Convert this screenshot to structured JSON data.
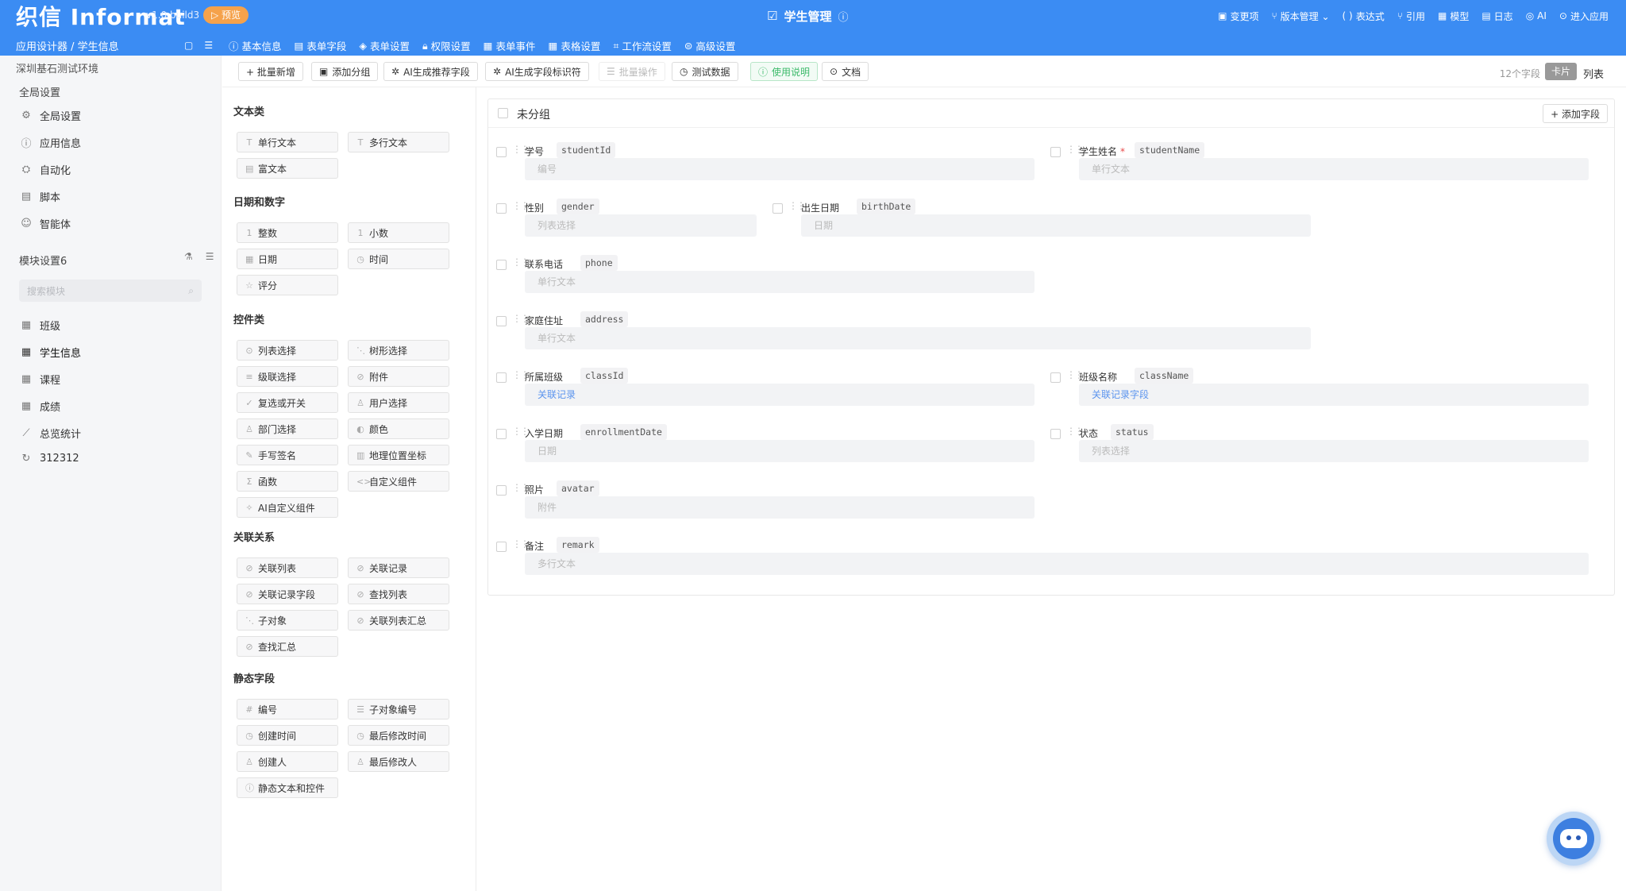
{
  "header": {
    "logo": "织信 Informat",
    "version": "v1.0 build3",
    "preview_label": "▷ 预览",
    "app_title": "学生管理",
    "actions": [
      {
        "icon": "changes-icon",
        "label": "变更项"
      },
      {
        "icon": "version-icon",
        "label": "版本管理 ⌄"
      },
      {
        "icon": "expression-icon",
        "label": "表达式"
      },
      {
        "icon": "reference-icon",
        "label": "引用"
      },
      {
        "icon": "model-icon",
        "label": "模型"
      },
      {
        "icon": "log-icon",
        "label": "日志"
      },
      {
        "icon": "ai-icon",
        "label": "AI"
      },
      {
        "icon": "enter-app-icon",
        "label": "进入应用"
      }
    ],
    "breadcrumb": "应用设计器 / 学生信息",
    "tabs": [
      "基本信息",
      "表单字段",
      "表单设置",
      "权限设置",
      "表单事件",
      "表格设置",
      "工作流设置",
      "高级设置"
    ]
  },
  "sidebar": {
    "env": "深圳基石测试环境",
    "global_title": "全局设置",
    "global_items": [
      {
        "icon": "gear-icon",
        "label": "全局设置"
      },
      {
        "icon": "info-icon",
        "label": "应用信息"
      },
      {
        "icon": "robot-icon",
        "label": "自动化"
      },
      {
        "icon": "script-icon",
        "label": "脚本"
      },
      {
        "icon": "agent-icon",
        "label": "智能体"
      }
    ],
    "module_title": "模块设置6",
    "search_placeholder": "搜索模块",
    "modules": [
      {
        "icon": "table-icon",
        "label": "班级"
      },
      {
        "icon": "table-icon",
        "label": "学生信息"
      },
      {
        "icon": "table-icon",
        "label": "课程"
      },
      {
        "icon": "table-icon",
        "label": "成绩"
      },
      {
        "icon": "chart-icon",
        "label": "总览统计"
      },
      {
        "icon": "refresh-icon",
        "label": "312312"
      }
    ]
  },
  "toolbar": {
    "buttons": [
      "+ 批量新增",
      "添加分组",
      "AI生成推荐字段",
      "AI生成字段标识符",
      "批量操作",
      "测试数据",
      "使用说明",
      "文档"
    ],
    "field_count": "12个字段",
    "view_card": "卡片",
    "view_list": "列表"
  },
  "palette": {
    "categories": [
      {
        "title": "文本类",
        "items": [
          {
            "icon": "T",
            "label": "单行文本"
          },
          {
            "icon": "T",
            "label": "多行文本"
          },
          {
            "icon": "▤",
            "label": "富文本"
          }
        ]
      },
      {
        "title": "日期和数字",
        "items": [
          {
            "icon": "1",
            "label": "整数"
          },
          {
            "icon": "1",
            "label": "小数"
          },
          {
            "icon": "▦",
            "label": "日期"
          },
          {
            "icon": "◷",
            "label": "时间"
          },
          {
            "icon": "☆",
            "label": "评分"
          }
        ]
      },
      {
        "title": "控件类",
        "items": [
          {
            "icon": "⊙",
            "label": "列表选择"
          },
          {
            "icon": "⋱",
            "label": "树形选择"
          },
          {
            "icon": "≡",
            "label": "级联选择"
          },
          {
            "icon": "⊘",
            "label": "附件"
          },
          {
            "icon": "✓",
            "label": "复选或开关"
          },
          {
            "icon": "♙",
            "label": "用户选择"
          },
          {
            "icon": "♙",
            "label": "部门选择"
          },
          {
            "icon": "◐",
            "label": "颜色"
          },
          {
            "icon": "✎",
            "label": "手写签名"
          },
          {
            "icon": "▥",
            "label": "地理位置坐标"
          },
          {
            "icon": "Σ",
            "label": "函数"
          },
          {
            "icon": "<>",
            "label": "自定义组件"
          },
          {
            "icon": "✧",
            "label": "AI自定义组件"
          }
        ]
      },
      {
        "title": "关联关系",
        "items": [
          {
            "icon": "⊘",
            "label": "关联列表"
          },
          {
            "icon": "⊘",
            "label": "关联记录"
          },
          {
            "icon": "⊘",
            "label": "关联记录字段"
          },
          {
            "icon": "⊘",
            "label": "查找列表"
          },
          {
            "icon": "⋱",
            "label": "子对象"
          },
          {
            "icon": "⊘",
            "label": "关联列表汇总"
          },
          {
            "icon": "⊘",
            "label": "查找汇总"
          }
        ]
      },
      {
        "title": "静态字段",
        "items": [
          {
            "icon": "#",
            "label": "编号"
          },
          {
            "icon": "☰",
            "label": "子对象编号"
          },
          {
            "icon": "◷",
            "label": "创建时间"
          },
          {
            "icon": "◷",
            "label": "最后修改时间"
          },
          {
            "icon": "♙",
            "label": "创建人"
          },
          {
            "icon": "♙",
            "label": "最后修改人"
          },
          {
            "icon": "ⓘ",
            "label": "静态文本和控件"
          }
        ]
      }
    ]
  },
  "form": {
    "group_title": "未分组",
    "add_field": "+ 添加字段",
    "fields": [
      {
        "label": "学号",
        "key": "studentId",
        "placeholder": "编号",
        "required": false
      },
      {
        "label": "学生姓名",
        "key": "studentName",
        "placeholder": "单行文本",
        "required": true
      },
      {
        "label": "性别",
        "key": "gender",
        "placeholder": "列表选择",
        "required": false
      },
      {
        "label": "出生日期",
        "key": "birthDate",
        "placeholder": "日期",
        "required": false
      },
      {
        "label": "联系电话",
        "key": "phone",
        "placeholder": "单行文本",
        "required": false
      },
      {
        "label": "家庭住址",
        "key": "address",
        "placeholder": "单行文本",
        "required": false
      },
      {
        "label": "所属班级",
        "key": "classId",
        "placeholder": "关联记录",
        "required": false
      },
      {
        "label": "班级名称",
        "key": "className",
        "placeholder": "关联记录字段",
        "required": false
      },
      {
        "label": "入学日期",
        "key": "enrollmentDate",
        "placeholder": "日期",
        "required": false
      },
      {
        "label": "状态",
        "key": "status",
        "placeholder": "列表选择",
        "required": false
      },
      {
        "label": "照片",
        "key": "avatar",
        "placeholder": "附件",
        "required": false
      },
      {
        "label": "备注",
        "key": "remark",
        "placeholder": "多行文本",
        "required": false
      }
    ]
  },
  "colors": {
    "primary": "#3b8cf3",
    "link": "#5b94ee",
    "success": "#3cba6a",
    "required": "#e84a4a"
  }
}
